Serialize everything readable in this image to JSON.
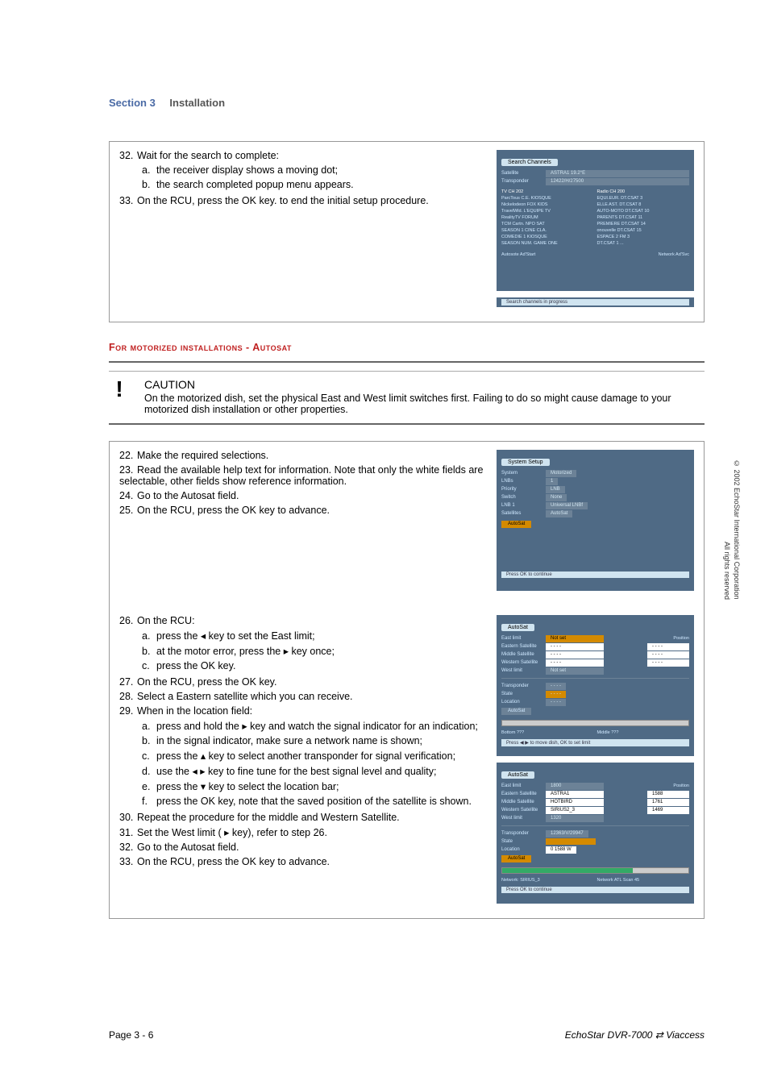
{
  "header": {
    "section": "Section 3",
    "title": "Installation"
  },
  "box1": {
    "step32": {
      "num": "32.",
      "text": "Wait for the search to complete:"
    },
    "step32a": {
      "lab": "a.",
      "text": "the receiver display shows a moving dot;"
    },
    "step32b": {
      "lab": "b.",
      "text": "the search completed popup menu appears."
    },
    "step33": {
      "num": "33.",
      "text": "On the RCU, press the OK key. to end the initial setup procedure."
    }
  },
  "sub1": "For motorized installations - Autosat",
  "caution": {
    "icon": "!",
    "title": "CAUTION",
    "body": "On the motorized dish, set the physical East and West limit switches first. Failing to do so might cause damage to your motorized dish installation or other properties."
  },
  "box2a": {
    "step22": {
      "num": "22.",
      "text": "Make the required selections."
    },
    "step23": {
      "num": "23.",
      "text": "Read the available help text for information. Note that only the white fields are selectable, other fields show reference information."
    },
    "step24": {
      "num": "24.",
      "text": "Go to the Autosat field."
    },
    "step25": {
      "num": "25.",
      "text": "On the RCU, press the OK key to advance."
    }
  },
  "box2b": {
    "step26": {
      "num": "26.",
      "text": "On the RCU:"
    },
    "step26a": {
      "lab": "a.",
      "text": "press the ◂ key to set the East limit;"
    },
    "step26b": {
      "lab": "b.",
      "text": "at the motor error, press the ▸ key once;"
    },
    "step26c": {
      "lab": "c.",
      "text": "press the OK key."
    },
    "step27": {
      "num": "27.",
      "text": "On the RCU, press the OK key."
    },
    "step28": {
      "num": "28.",
      "text": "Select a Eastern satellite which you can receive."
    },
    "step29": {
      "num": "29.",
      "text": "When in the location field:"
    },
    "step29a": {
      "lab": "a.",
      "text": "press and hold the ▸ key and watch the signal indicator for an indication;"
    },
    "step29b": {
      "lab": "b.",
      "text": "in the signal indicator, make sure a network name is shown;"
    },
    "step29c": {
      "lab": "c.",
      "text": "press the ▴ key to select another transponder for signal verification;"
    },
    "step29d": {
      "lab": "d.",
      "text": "use the ◂  ▸ key to fine tune for the best signal level and quality;"
    },
    "step29e": {
      "lab": "e.",
      "text": "press the ▾ key to select the location bar;"
    },
    "step29f": {
      "lab": "f.",
      "text": "press the OK key, note that the saved position of the satellite is shown."
    },
    "step30": {
      "num": "30.",
      "text": "Repeat the procedure for the middle and Western Satellite."
    },
    "step31": {
      "num": "31.",
      "text": "Set the West limit ( ▸ key), refer to step 26."
    },
    "step32": {
      "num": "32.",
      "text": "Go to the Autosat field."
    },
    "step33": {
      "num": "33.",
      "text": "On the RCU, press the OK key to advance."
    }
  },
  "screens": {
    "search": {
      "tab": "Search Channels",
      "sat_label": "Satellite",
      "sat_val": "ASTRA1 19.2°E",
      "tp_label": "Transponder",
      "tp_val": "12422/H/27500",
      "tv_hdr": "TV CH 202",
      "radio_hdr": "Radio CH 200",
      "tv_rows": [
        "ParcTous C.E.   KIOSQUE",
        "Nickelodeon   FOX KIDS",
        "TravelWld.   L'EQUIPE TV",
        "RealityTV   FORUM",
        "TCM Cartn.   NPO SAT",
        "SEASON 1   CINE CLA.",
        "COMEDIE 1   KIOSQUE",
        "SEASON NUM.  GAME ONE"
      ],
      "radio_rows": [
        "EQUI.EUR.   DT.CSAT 3",
        "ELLE AST.   DT.CSAT 8",
        "AUTO-MOTO   DT.CSAT 10",
        "PARENTS   DT.CSAT 11",
        "PREMIERE   DT.CSAT 14",
        "onouvelle   DT.CSAT 15",
        "ESPACE 2   FM 3",
        "DT.CSAT 1   ..."
      ],
      "auto_l": "Autosote Ad'Start",
      "auto_r": "Network Ad'Svc",
      "bar": "Search channels in progress"
    },
    "system": {
      "tab": "System Setup",
      "rows": [
        {
          "l": "System",
          "v": "Motorized"
        },
        {
          "l": "LNBs",
          "v": "1"
        },
        {
          "l": "Priority",
          "v": "LNB"
        },
        {
          "l": "Switch",
          "v": "None"
        },
        {
          "l": "LNB 1",
          "v": "Universal LNBf"
        },
        {
          "l": "Satellites",
          "v": "AutoSat"
        }
      ],
      "btn": "AutoSat",
      "bar": "Press OK to continue"
    },
    "autosat1": {
      "tab": "AutoSat",
      "rows": [
        {
          "l": "East limit",
          "v": "Not set",
          "p": "Position"
        },
        {
          "l": "Eastern Satellite",
          "v": "- - - -",
          "p": "- - - -"
        },
        {
          "l": "Middle Satellite",
          "v": "- - - -",
          "p": "- - - -"
        },
        {
          "l": "Western Satellite",
          "v": "- - - -",
          "p": "- - - -"
        },
        {
          "l": "West limit",
          "v": "Not set",
          "p": ""
        }
      ],
      "rows2": [
        {
          "l": "Transponder",
          "v": "- - - -"
        },
        {
          "l": "State",
          "v": "- - - -"
        },
        {
          "l": "Location",
          "v": "- - - -"
        }
      ],
      "btn": "AutoSat",
      "meter_l": "Bottom ???",
      "meter_r": "Middle ???",
      "bar": "Press ◀ ▶ to move dish, OK to set limit"
    },
    "autosat2": {
      "tab": "AutoSat",
      "rows": [
        {
          "l": "East limit",
          "v": "1800",
          "p": "Position"
        },
        {
          "l": "Eastern Satellite",
          "v": "ASTRA1",
          "p": "1588"
        },
        {
          "l": "Middle Satellite",
          "v": "HOTBIRD",
          "p": "1761"
        },
        {
          "l": "Western Satellite",
          "v": "SIRIUS2_3",
          "p": "1469"
        },
        {
          "l": "West limit",
          "v": "1320",
          "p": ""
        }
      ],
      "rows2": [
        {
          "l": "Transponder",
          "v": "12363/V/29947"
        },
        {
          "l": "State",
          "v": ""
        },
        {
          "l": "Location",
          "v": "0   1588   W"
        }
      ],
      "btn": "AutoSat",
      "meter_l": "Network: SIRIUS_3",
      "meter_r": "Network ATL Scan 45",
      "bar": "Press OK to continue"
    }
  },
  "footer": {
    "left": "Page 3 - 6",
    "right": "EchoStar DVR-7000 ⇄ Viaccess"
  },
  "side": {
    "l1": "© 2002 EchoStar International Corporation",
    "l2": "All rights reserved"
  }
}
